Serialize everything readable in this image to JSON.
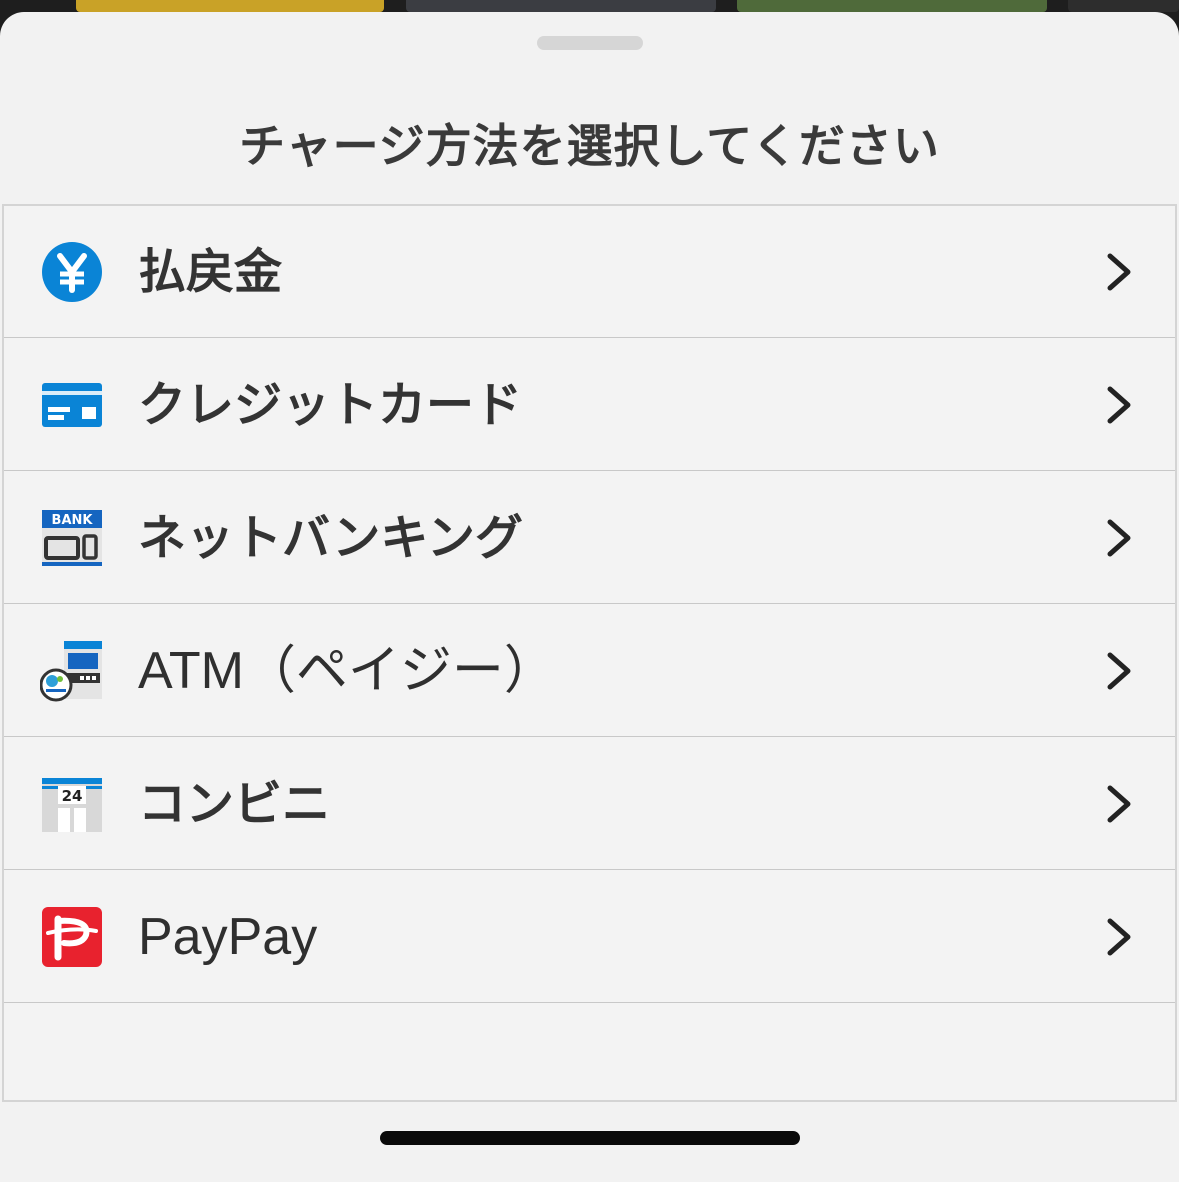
{
  "sheet": {
    "title": "チャージ方法を選択してください"
  },
  "methods": [
    {
      "label": "払戻金",
      "icon": "yen-coin-icon",
      "latin": false
    },
    {
      "label": "クレジットカード",
      "icon": "credit-card-icon",
      "latin": false
    },
    {
      "label": "ネットバンキング",
      "icon": "bank-icon",
      "latin": false
    },
    {
      "label": "ATM（ペイジー）",
      "icon": "atm-payeasy-icon",
      "latin": true
    },
    {
      "label": "コンビニ",
      "icon": "convenience-store-icon",
      "latin": false
    },
    {
      "label": "PayPay",
      "icon": "paypay-icon",
      "latin": true
    }
  ],
  "colors": {
    "blue": "#0a84d6",
    "paypay_red": "#e8222e",
    "text": "#333333",
    "background": "#f2f2f2"
  }
}
